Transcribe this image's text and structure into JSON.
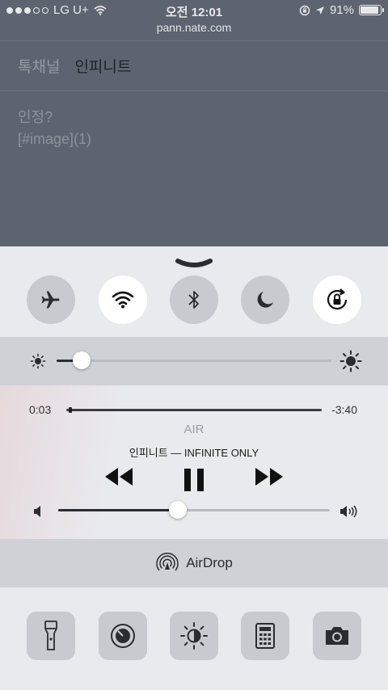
{
  "status_bar": {
    "carrier": "LG U+",
    "time": "오전 12:01",
    "battery_percent": "91%",
    "battery_level": 0.91,
    "signal_bars_filled": 3,
    "signal_bars_total": 5
  },
  "browser": {
    "url": "pann.nate.com",
    "tabs": [
      "톡채널",
      "인피니트"
    ],
    "post_title": "인정?",
    "post_body": "[#image](1)"
  },
  "control_center": {
    "toggles": [
      {
        "icon": "airplane-icon",
        "on": false
      },
      {
        "icon": "wifi-icon",
        "on": true
      },
      {
        "icon": "bluetooth-icon",
        "on": false
      },
      {
        "icon": "moon-icon",
        "on": false
      },
      {
        "icon": "rotation-lock-icon",
        "on": true
      }
    ],
    "brightness_level": 0.09,
    "media": {
      "elapsed": "0:03",
      "remaining": "-3:40",
      "progress": 0.01,
      "source": "AIR",
      "song": "인피니트 — INFINITE ONLY",
      "volume_level": 0.44
    },
    "airdrop_label": "AirDrop",
    "quick_actions": [
      "flashlight-icon",
      "timer-icon",
      "night-shift-icon",
      "calculator-icon",
      "camera-icon"
    ]
  },
  "colors": {
    "accent_on": "#ffffff",
    "toggle_off": "#c8cad0",
    "panel_bg": "#e9eaee",
    "dim_bg": "#5d6470"
  }
}
